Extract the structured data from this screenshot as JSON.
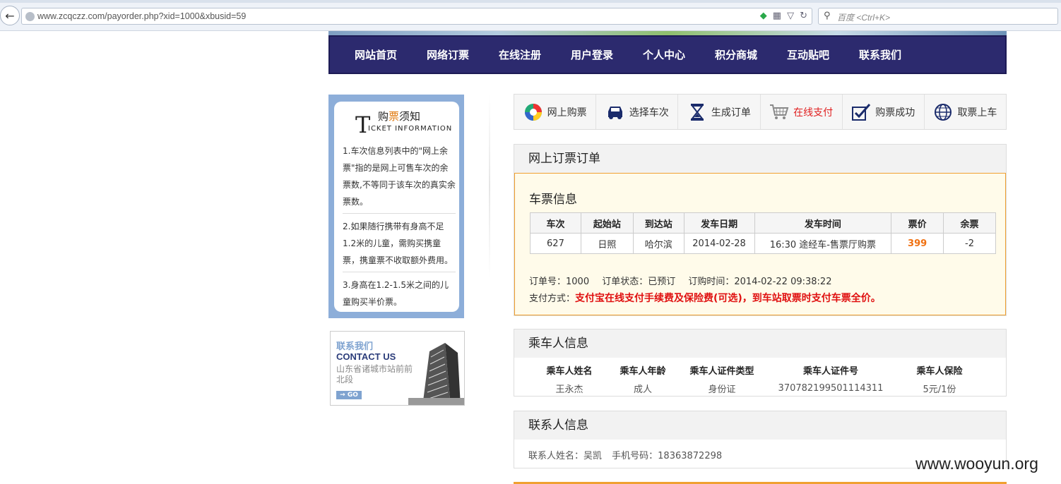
{
  "browser": {
    "url": "www.zcqczz.com/payorder.php?xid=1000&xbusid=59",
    "search_placeholder": "百度 <Ctrl+K>"
  },
  "nav": {
    "items": [
      "网站首页",
      "网络订票",
      "在线注册",
      "用户登录",
      "个人中心",
      "积分商城",
      "互动贴吧",
      "联系我们"
    ]
  },
  "notice": {
    "title_big": "T",
    "title_pre": "购",
    "title_hl": "票",
    "title_post": "须知",
    "title_en": "ICKET INFORMATION",
    "items": [
      "1.车次信息列表中的\"网上余票\"指的是网上可售车次的余票数,不等同于该车次的真实余票数。",
      "2.如果随行携带有身高不足1.2米的儿童，需购买携童票，携童票不收取额外费用。",
      "3.身高在1.2-1.5米之间的儿童购买半价票。"
    ]
  },
  "contact_box": {
    "title_cn": "联系我们",
    "title_en": "CONTACT US",
    "address": "山东省诸城市站前前北段",
    "go": "→ GO"
  },
  "steps": [
    {
      "label": "网上购票",
      "icon": "color-wheel-icon"
    },
    {
      "label": "选择车次",
      "icon": "car-icon"
    },
    {
      "label": "生成订单",
      "icon": "hourglass-icon"
    },
    {
      "label": "在线支付",
      "icon": "cart-icon"
    },
    {
      "label": "购票成功",
      "icon": "checkbox-icon"
    },
    {
      "label": "取票上车",
      "icon": "globe-icon"
    }
  ],
  "order": {
    "heading": "网上订票订单",
    "ticket_title": "车票信息",
    "columns": [
      "车次",
      "起始站",
      "到达站",
      "发车日期",
      "发车时间",
      "票价",
      "余票"
    ],
    "row": [
      "627",
      "日照",
      "哈尔滨",
      "2014-02-28",
      "16:30 途经车-售票厅购票",
      "399",
      "-2"
    ],
    "order_no": "订单号：1000",
    "status": "订单状态：已预订",
    "time": "订购时间：2014-02-22 09:38:22",
    "pay_label": "支付方式：",
    "pay_text": "支付宝在线支付手续费及保险费(可选)，到车站取票时支付车票全价。"
  },
  "passenger": {
    "heading": "乘车人信息",
    "columns": [
      "乘车人姓名",
      "乘车人年龄",
      "乘车人证件类型",
      "乘车人证件号",
      "乘车人保险"
    ],
    "row": [
      "王永杰",
      "成人",
      "身份证",
      "370782199501114311",
      "5元/1份"
    ]
  },
  "contact": {
    "heading": "联系人信息",
    "name": "联系人姓名：吴凯",
    "phone": "手机号码：18363872298"
  },
  "watermark": "www.wooyun.org",
  "colors": {
    "nav_bg": "#2c2a6e",
    "active_step": "#e02020",
    "price": "#f07010",
    "pay_red": "#e01010"
  }
}
